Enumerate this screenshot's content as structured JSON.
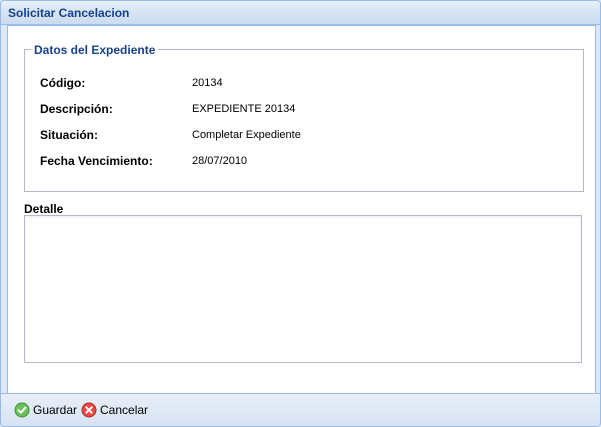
{
  "window": {
    "title": "Solicitar Cancelacion"
  },
  "fieldset": {
    "legend": "Datos del Expediente",
    "rows": [
      {
        "label": "Código:",
        "value": "20134"
      },
      {
        "label": "Descripción:",
        "value": "EXPEDIENTE 20134"
      },
      {
        "label": "Situación:",
        "value": "Completar Expediente"
      },
      {
        "label": "Fecha Vencimiento:",
        "value": "28/07/2010"
      }
    ]
  },
  "detalle": {
    "label": "Detalle",
    "value": ""
  },
  "footer": {
    "save_label": "Guardar",
    "cancel_label": "Cancelar",
    "save_icon": "checkmark-icon",
    "cancel_icon": "cancel-icon"
  },
  "colors": {
    "title_text": "#15428b",
    "border": "#99bbe8",
    "save_icon": "#5db64a",
    "cancel_icon": "#e0403a"
  }
}
